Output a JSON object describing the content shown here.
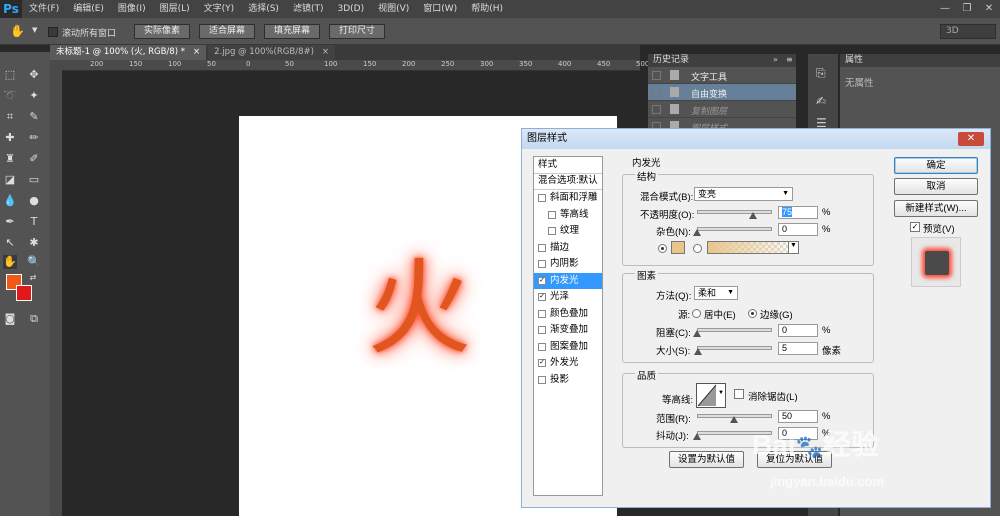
{
  "menubar": {
    "logo": "Ps",
    "items": [
      "文件(F)",
      "编辑(E)",
      "图像(I)",
      "图层(L)",
      "文字(Y)",
      "选择(S)",
      "滤镜(T)",
      "3D(D)",
      "视图(V)",
      "窗口(W)",
      "帮助(H)"
    ]
  },
  "options": {
    "scroll_all": "滚动所有窗口",
    "actual_pixels": "实际像素",
    "fit_screen": "适合屏幕",
    "fill_screen": "填充屏幕",
    "print_size": "打印尺寸",
    "workspace": "3D"
  },
  "tabs": [
    {
      "label": "未标题-1 @ 100% (火, RGB/8) *",
      "close": "×"
    },
    {
      "label": "2.jpg @ 100%(RGB/8#)",
      "close": "×"
    }
  ],
  "ruler": [
    "200",
    "150",
    "100",
    "50",
    "0",
    "50",
    "100",
    "150",
    "200",
    "250",
    "300",
    "350",
    "400",
    "450",
    "500"
  ],
  "canvas": {
    "text": "火"
  },
  "history": {
    "title": "历史记录",
    "items": [
      "文字工具",
      "自由变换",
      "复制图层",
      "图层样式"
    ]
  },
  "properties": {
    "title": "属性",
    "empty": "无属性"
  },
  "dialog": {
    "title": "图层样式",
    "close": "✕",
    "style_list": [
      {
        "label": "样式",
        "checkbox": false,
        "checked": false,
        "indent": false,
        "selected": false
      },
      {
        "label": "混合选项:默认",
        "checkbox": false,
        "checked": false,
        "indent": false,
        "selected": false
      },
      {
        "label": "斜面和浮雕",
        "checkbox": true,
        "checked": false,
        "indent": false,
        "selected": false
      },
      {
        "label": "等高线",
        "checkbox": true,
        "checked": false,
        "indent": true,
        "selected": false
      },
      {
        "label": "纹理",
        "checkbox": true,
        "checked": false,
        "indent": true,
        "selected": false
      },
      {
        "label": "描边",
        "checkbox": true,
        "checked": false,
        "indent": false,
        "selected": false
      },
      {
        "label": "内阴影",
        "checkbox": true,
        "checked": false,
        "indent": false,
        "selected": false
      },
      {
        "label": "内发光",
        "checkbox": true,
        "checked": true,
        "indent": false,
        "selected": true
      },
      {
        "label": "光泽",
        "checkbox": true,
        "checked": true,
        "indent": false,
        "selected": false
      },
      {
        "label": "颜色叠加",
        "checkbox": true,
        "checked": false,
        "indent": false,
        "selected": false
      },
      {
        "label": "渐变叠加",
        "checkbox": true,
        "checked": false,
        "indent": false,
        "selected": false
      },
      {
        "label": "图案叠加",
        "checkbox": true,
        "checked": false,
        "indent": false,
        "selected": false
      },
      {
        "label": "外发光",
        "checkbox": true,
        "checked": true,
        "indent": false,
        "selected": false
      },
      {
        "label": "投影",
        "checkbox": true,
        "checked": false,
        "indent": false,
        "selected": false
      }
    ],
    "section_title": "内发光",
    "structure": {
      "title": "结构",
      "blend_mode_label": "混合模式(B):",
      "blend_mode": "变亮",
      "opacity_label": "不透明度(O):",
      "opacity": "75",
      "noise_label": "杂色(N):",
      "noise": "0",
      "percent": "%",
      "opacity_level": 0.75,
      "glow_color": "#e9c58c"
    },
    "elements": {
      "title": "图素",
      "method_label": "方法(Q):",
      "method": "柔和",
      "source_label": "源:",
      "center": "居中(E)",
      "edge": "边缘(G)",
      "choke_label": "阻塞(C):",
      "choke": "0",
      "size_label": "大小(S):",
      "size": "5",
      "px": "像素",
      "percent": "%"
    },
    "quality": {
      "title": "品质",
      "contour_label": "等高线:",
      "anti_alias": "消除锯齿(L)",
      "range_label": "范围(R):",
      "range": "50",
      "jitter_label": "抖动(J):",
      "jitter": "0",
      "percent": "%"
    },
    "make_default": "设置为默认值",
    "reset_default": "复位为默认值",
    "ok": "确定",
    "cancel": "取消",
    "new_style": "新建样式(W)...",
    "preview": "预览(V)"
  },
  "watermark": {
    "brand": "Bai",
    "brand2": "经验",
    "url": "jingyan.baidu.com"
  },
  "colors": {
    "foreground": "#f05a14",
    "background": "#e01818",
    "accent": "#3399ff"
  }
}
